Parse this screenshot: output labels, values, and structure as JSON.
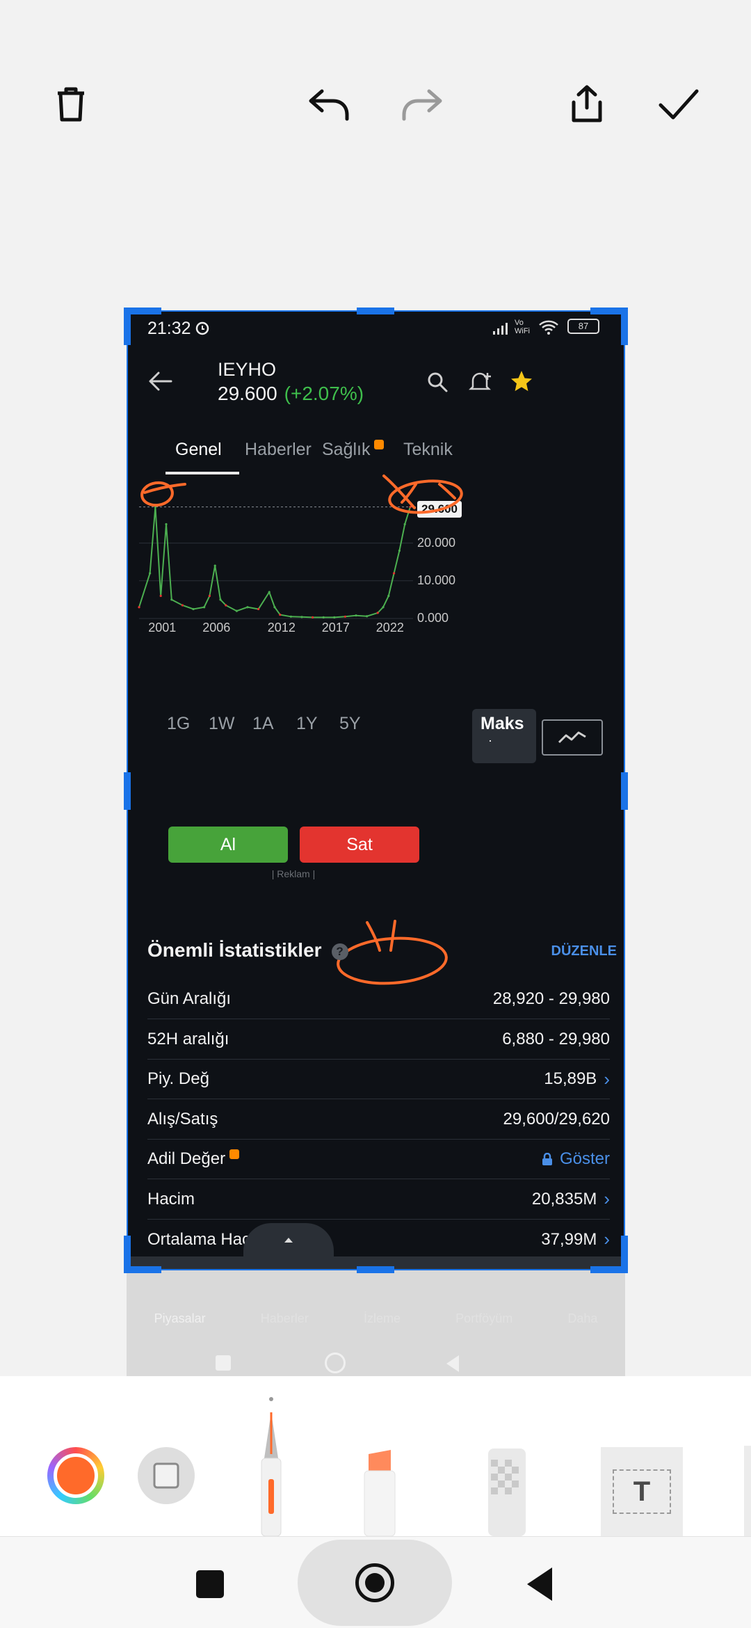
{
  "status": {
    "time": "21:32",
    "battery": "87",
    "signal_label": "Vo WiFi"
  },
  "stock": {
    "symbol": "IEYHO",
    "price": "29.600",
    "change": "(+2.07%)"
  },
  "tabs": [
    "Genel",
    "Haberler",
    "Sağlık",
    "Teknik"
  ],
  "chart_data": {
    "type": "line",
    "x": [
      "1999",
      "2000",
      "2000.5",
      "2001",
      "2001.5",
      "2002",
      "2003",
      "2004",
      "2005",
      "2005.5",
      "2006",
      "2006.5",
      "2007",
      "2008",
      "2009",
      "2010",
      "2011",
      "2011.5",
      "2012",
      "2013",
      "2014",
      "2015",
      "2016",
      "2017",
      "2018",
      "2019",
      "2020",
      "2021",
      "2021.5",
      "2022",
      "2022.5",
      "2023",
      "2023.5",
      "2024"
    ],
    "values": [
      3000,
      12000,
      29600,
      6000,
      25000,
      5000,
      3500,
      2500,
      3000,
      6000,
      14000,
      5000,
      3500,
      2000,
      3000,
      2500,
      7000,
      3000,
      1000,
      500,
      400,
      300,
      300,
      300,
      500,
      800,
      600,
      1500,
      3000,
      6000,
      12000,
      18000,
      25000,
      29600
    ],
    "x_ticks": [
      "2001",
      "2006",
      "2012",
      "2017",
      "2022"
    ],
    "y_ticks": [
      "0.000",
      "10.000",
      "20.000"
    ],
    "last_price_label": "29.600",
    "ylim": [
      0,
      31000
    ],
    "grid": true
  },
  "ranges": [
    "1G",
    "1W",
    "1A",
    "1Y",
    "5Y",
    "Maks"
  ],
  "ranges_active_dot": "·",
  "actions": {
    "buy": "Al",
    "sell": "Sat",
    "ad": "| Reklam |"
  },
  "stats": {
    "title": "Önemli İstatistikler",
    "edit": "DÜZENLE",
    "rows": [
      {
        "label": "Gün Aralığı",
        "value": "28,920 - 29,980"
      },
      {
        "label": "52H aralığı",
        "value": "6,880 - 29,980"
      },
      {
        "label": "Piy. Değ",
        "value": "15,89B"
      },
      {
        "label": "Alış/Satış",
        "value": "29,600/29,620"
      },
      {
        "label": "Adil Değer",
        "value": "Göster"
      },
      {
        "label": "Hacim",
        "value": "20,835M"
      },
      {
        "label": "Ortalama Hacim (3Ay)",
        "value": "37,99M"
      }
    ]
  },
  "bottom_nav_faded": [
    "Piyasalar",
    "Haberler",
    "İzleme",
    "Portföyüm",
    "Daha"
  ],
  "editor": {
    "text_tool": "T"
  },
  "colors": {
    "up": "#3fbf4c",
    "down": "#e3342f",
    "accent": "#4a8fe7",
    "annotation": "#ff6a2a",
    "selection": "#1a73e8"
  }
}
